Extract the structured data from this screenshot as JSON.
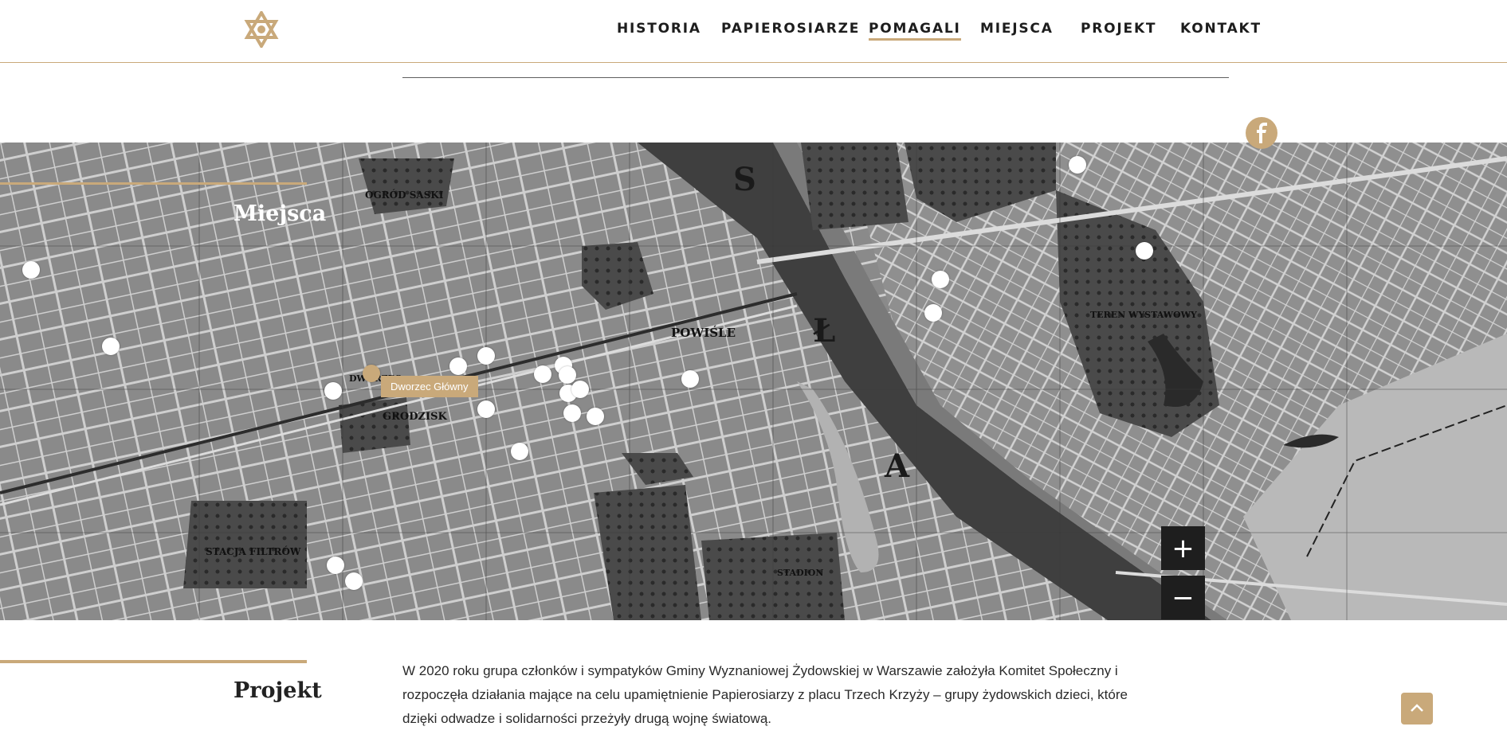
{
  "nav": {
    "items": [
      {
        "label": "HISTORIA",
        "active": false
      },
      {
        "label": "PAPIEROSIARZE",
        "active": false
      },
      {
        "label": "POMAGALI",
        "active": true
      },
      {
        "label": "MIEJSCA",
        "active": false
      },
      {
        "label": "PROJEKT",
        "active": false
      },
      {
        "label": "KONTAKT",
        "active": false
      }
    ]
  },
  "colors": {
    "accent": "#c9a97a",
    "map_dark": "#1e1e1e",
    "text": "#222222"
  },
  "icons": {
    "logo": "star-of-david-logo-icon",
    "social": "facebook-icon",
    "scroll_top": "chevron-up-icon"
  },
  "map": {
    "title": "Miejsca",
    "active_label": "Dworzec Główny",
    "labels": {
      "ogrod_saski": "OGRÓD SASKI",
      "powisle": "POWIŚLE",
      "stacja_filtrow": "STACJA FILTRÓW",
      "stadion": "STADION",
      "teren_wystawowy": "TEREN WYSTAWOWY",
      "grodzisk": "GRODZISK",
      "dworzec": "DWORZEC",
      "wisla_letters": [
        "S",
        "Ł",
        "A"
      ]
    },
    "zoom_in": "+",
    "zoom_out": "−",
    "marker_count": 25
  },
  "project": {
    "title": "Projekt",
    "text": "W 2020 roku grupa członków i sympatyków Gminy Wyznaniowej Żydowskiej w Warszawie założyła Komitet Społeczny i rozpoczęła działania mające na celu upamiętnienie Papierosiarzy z placu Trzech Krzyży – grupy żydowskich dzieci, które dzięki odwadze i solidarności przeżyły drugą wojnę światową."
  }
}
